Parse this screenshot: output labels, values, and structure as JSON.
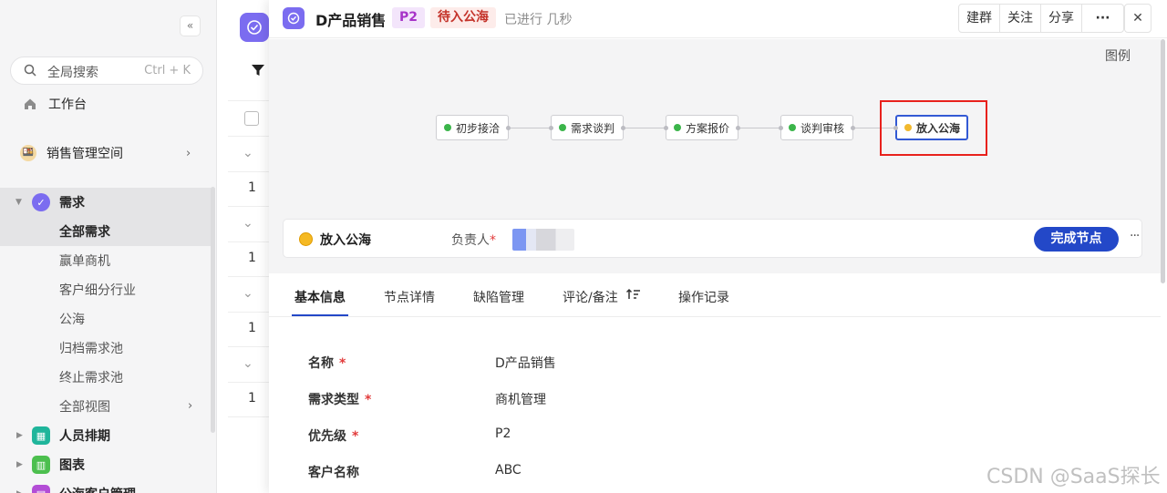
{
  "sidebar": {
    "search": {
      "label": "全局搜索",
      "shortcut": "Ctrl + K"
    },
    "workbench": "工作台",
    "space": "销售管理空间",
    "demand_app": "需求",
    "views": [
      "全部需求",
      "赢单商机",
      "客户细分行业",
      "公海",
      "归档需求池",
      "终止需求池",
      "全部视图"
    ],
    "apps": [
      "人员排期",
      "图表",
      "公海客户管理"
    ]
  },
  "midlist": {
    "row_values": [
      "1",
      "1",
      "1",
      "1"
    ]
  },
  "drawer": {
    "title": "D产品销售",
    "priority_tag": "P2",
    "status_tag": "待入公海",
    "duration": "已进行 几秒",
    "actions": [
      "建群",
      "关注",
      "分享",
      "···"
    ],
    "close": "✕",
    "legend": "图例",
    "flow_nodes": [
      "初步接洽",
      "需求谈判",
      "方案报价",
      "谈判审核",
      "放入公海"
    ],
    "current_node": {
      "name": "放入公海",
      "owner_label": "负责人",
      "required_mark": "*",
      "complete_button": "完成节点",
      "more": "···"
    },
    "tabs": [
      "基本信息",
      "节点详情",
      "缺陷管理",
      "评论/备注",
      "操作记录"
    ],
    "fields": [
      {
        "label": "名称",
        "value": "D产品销售"
      },
      {
        "label": "需求类型",
        "value": "商机管理"
      },
      {
        "label": "优先级",
        "value": "P2"
      },
      {
        "label": "客户名称",
        "value": "ABC"
      }
    ]
  },
  "watermark": "CSDN @SaaS探长",
  "colors": {
    "accent": "#2348c8",
    "highlight": "#e8211c",
    "app_purple": "#7b6cf0"
  }
}
